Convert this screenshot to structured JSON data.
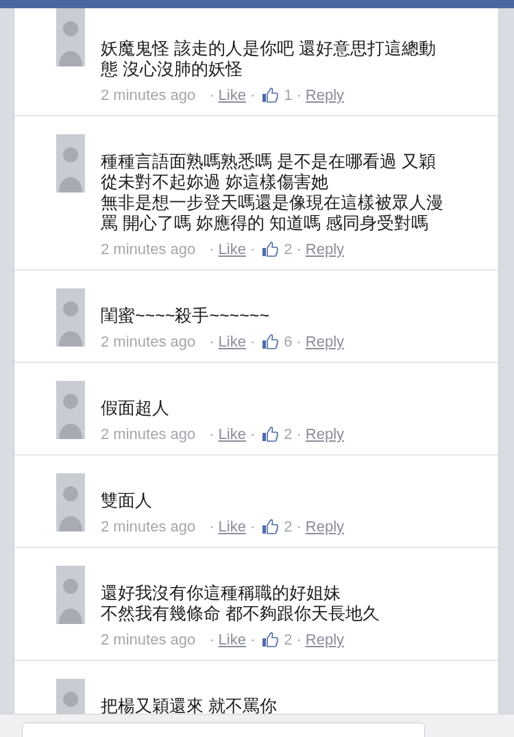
{
  "comments": [
    {
      "lines": [
        "妖魔鬼怪 該走的人是你吧 還好意思打這總動",
        "態 沒心沒肺的妖怪"
      ],
      "time": "2 minutes ago",
      "like": "Like",
      "likes": "1",
      "reply": "Reply",
      "separator": "·"
    },
    {
      "lines": [
        "種種言語面熟嗎熟悉嗎 是不是在哪看過 又穎",
        "從未對不起妳過 妳這樣傷害她",
        "無非是想一步登天嗎還是像現在這樣被眾人漫",
        "罵 開心了嗎 妳應得的 知道嗎 感同身受對嗎"
      ],
      "time": "2 minutes ago",
      "like": "Like",
      "likes": "2",
      "reply": "Reply",
      "separator": "·"
    },
    {
      "lines": [
        "閨蜜~~~~殺手~~~~~~"
      ],
      "time": "2 minutes ago",
      "like": "Like",
      "likes": "6",
      "reply": "Reply",
      "separator": "·"
    },
    {
      "lines": [
        "假面超人"
      ],
      "time": "2 minutes ago",
      "like": "Like",
      "likes": "2",
      "reply": "Reply",
      "separator": "·"
    },
    {
      "lines": [
        "雙面人"
      ],
      "time": "2 minutes ago",
      "like": "Like",
      "likes": "2",
      "reply": "Reply",
      "separator": "·"
    },
    {
      "lines": [
        "還好我沒有你這種稱職的好姐妹",
        "不然我有幾條命 都不夠跟你天長地久"
      ],
      "time": "2 minutes ago",
      "like": "Like",
      "likes": "2",
      "reply": "Reply",
      "separator": "·"
    },
    {
      "lines": [
        "把楊又穎還來 就不罵你"
      ]
    }
  ],
  "composer": {
    "kind": "field"
  }
}
